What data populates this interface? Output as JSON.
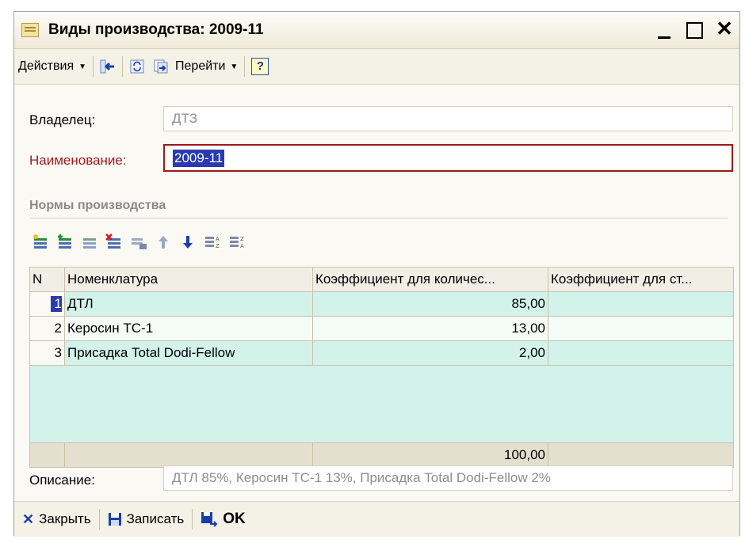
{
  "window": {
    "title": "Виды производства: 2009-11"
  },
  "toolbar": {
    "actions_label": "Действия",
    "goto_label": "Перейти",
    "help_label": "?"
  },
  "form": {
    "owner_label": "Владелец:",
    "owner_value": "ДТЗ",
    "name_label": "Наименование:",
    "name_value": "2009-11",
    "section_title": "Нормы производства",
    "description_label": "Описание:",
    "description_value": "ДТЛ 85%, Керосин ТС-1 13%, Присадка Total Dodi-Fellow 2%"
  },
  "table": {
    "headers": [
      "N",
      "Номенклатура",
      "Коэффициент для количес...",
      "Коэффициент для ст..."
    ],
    "rows": [
      {
        "n": "1",
        "item": "ДТЛ",
        "coef_qty": "85,00",
        "coef_cost": ""
      },
      {
        "n": "2",
        "item": "Керосин ТС-1",
        "coef_qty": "13,00",
        "coef_cost": ""
      },
      {
        "n": "3",
        "item": "Присадка Total Dodi-Fellow",
        "coef_qty": "2,00",
        "coef_cost": ""
      }
    ],
    "total_qty": "100,00"
  },
  "bottom": {
    "close_label": "Закрыть",
    "save_label": "Записать",
    "ok_label": "OK"
  },
  "colors": {
    "selection": "#2a3ab1",
    "row_highlight": "#d2f2ea",
    "required_border": "#9b1b1b",
    "required_label": "#9b1b1b"
  }
}
